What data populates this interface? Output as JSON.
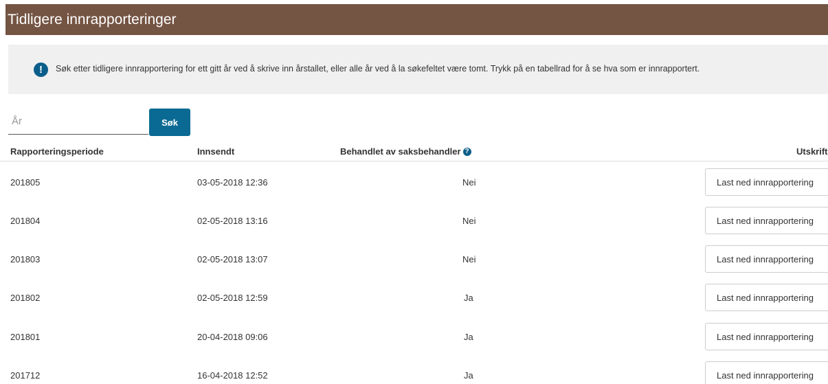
{
  "header": {
    "title": "Tidligere innrapporteringer"
  },
  "info": {
    "icon": "exclamation-icon",
    "text": "Søk etter tidligere innrapportering for ett gitt år ved å skrive inn årstallet, eller alle år ved å la søkefeltet være tomt. Trykk på en tabellrad for å se hva som er innrapportert."
  },
  "search": {
    "placeholder": "År",
    "value": "",
    "button_label": "Søk"
  },
  "table": {
    "columns": {
      "period": "Rapporteringsperiode",
      "sent": "Innsendt",
      "handled": "Behandlet av saksbehandler",
      "print": "Utskrift"
    },
    "rows": [
      {
        "period": "201805",
        "sent": "03-05-2018 12:36",
        "handled": "Nei",
        "action": "Last ned innrapportering"
      },
      {
        "period": "201804",
        "sent": "02-05-2018 13:16",
        "handled": "Nei",
        "action": "Last ned innrapportering"
      },
      {
        "period": "201803",
        "sent": "02-05-2018 13:07",
        "handled": "Nei",
        "action": "Last ned innrapportering"
      },
      {
        "period": "201802",
        "sent": "02-05-2018 12:59",
        "handled": "Ja",
        "action": "Last ned innrapportering"
      },
      {
        "period": "201801",
        "sent": "20-04-2018 09:06",
        "handled": "Ja",
        "action": "Last ned innrapportering"
      },
      {
        "period": "201712",
        "sent": "16-04-2018 12:52",
        "handled": "Ja",
        "action": "Last ned innrapportering"
      }
    ]
  },
  "colors": {
    "header_bg": "#745443",
    "accent": "#0b6a93",
    "info_bg": "#f0f0f0"
  }
}
